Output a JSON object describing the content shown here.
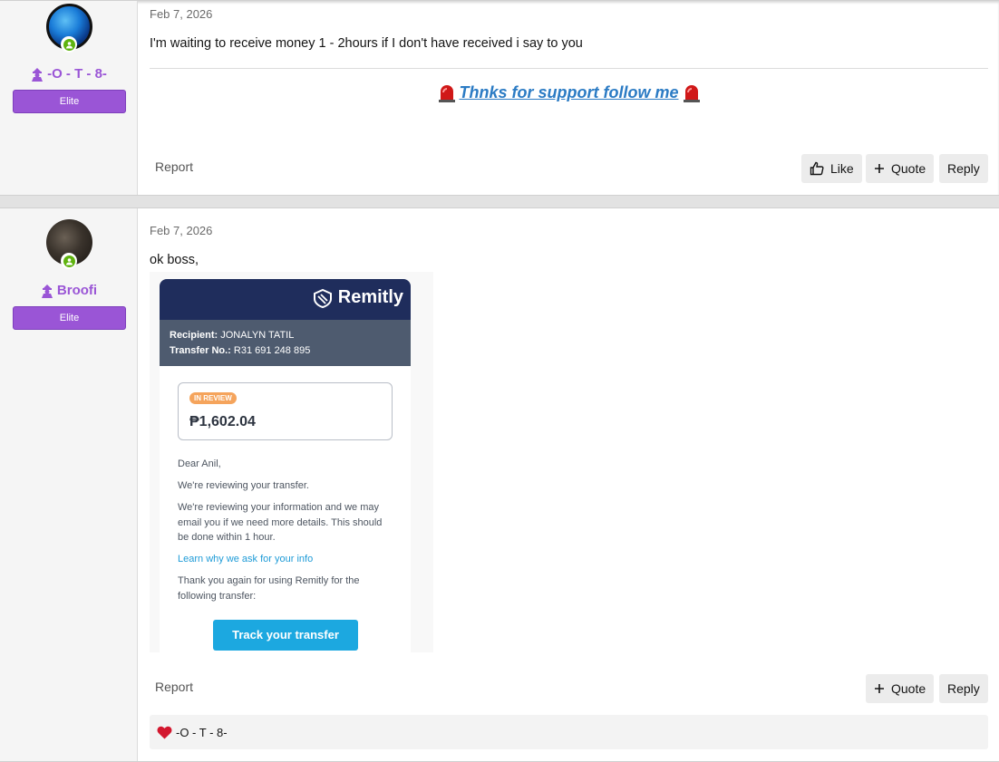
{
  "posts": [
    {
      "username": "-O - T - 8-",
      "badge": "Elite",
      "date": "Feb 7, 2026",
      "message": "I'm waiting to receive money 1 - 2hours if I don't have received i say to you",
      "signature": "Thnks for support follow me",
      "report": "Report",
      "like": "Like",
      "quote": "Quote",
      "reply": "Reply"
    },
    {
      "username": "Broofi",
      "badge": "Elite",
      "date": "Feb 7, 2026",
      "message": "ok boss,",
      "report": "Report",
      "quote": "Quote",
      "reply": "Reply",
      "reaction_user": "-O - T - 8-"
    }
  ],
  "remitly": {
    "brand": "Remitly",
    "recipient_label": "Recipient:",
    "recipient": "JONALYN TATIL",
    "transfer_label": "Transfer No.:",
    "transfer_no": "R31 691 248 895",
    "status": "IN REVIEW",
    "amount": "₱1,602.04",
    "greeting": "Dear Anil,",
    "line1": "We're reviewing your transfer.",
    "line2": "We're reviewing your information and we may email you if we need more details. This should be done within 1 hour.",
    "link": "Learn why we ask for your info",
    "line3": "Thank you again for using Remitly for the following transfer:",
    "button": "Track your transfer"
  },
  "colors": {
    "accent": "#9a55d6",
    "link": "#2b7bc4",
    "online": "#5fb30f",
    "remitly_navy": "#1f2d5c",
    "remitly_button": "#1ca8e0"
  }
}
